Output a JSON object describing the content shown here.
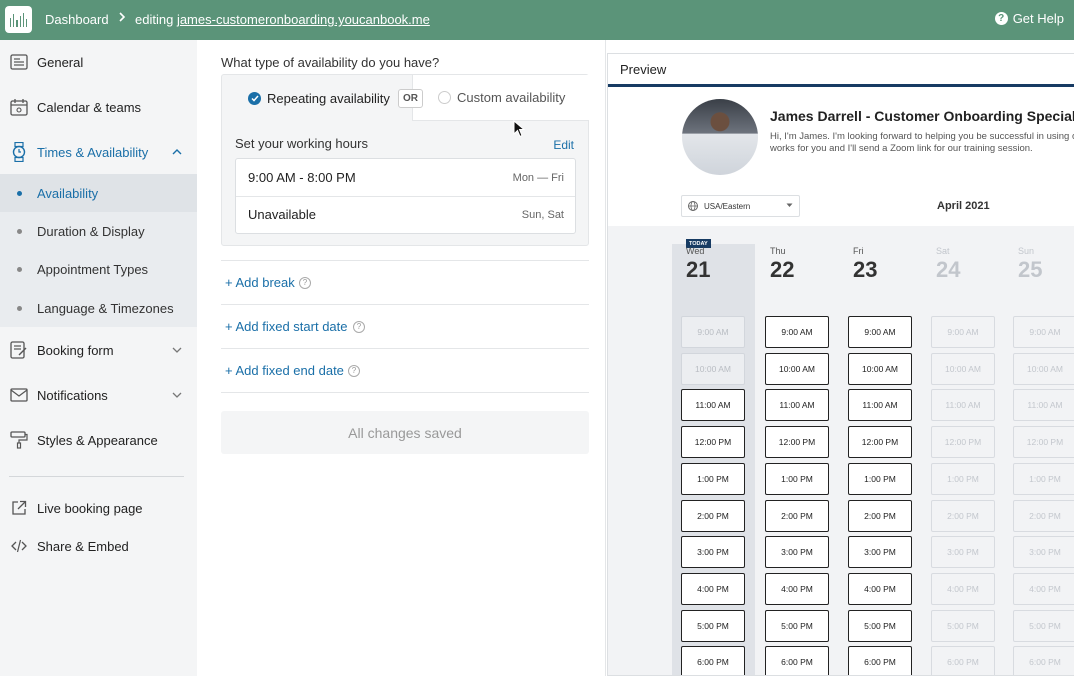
{
  "topbar": {
    "dashboard": "Dashboard",
    "separator": ">",
    "editing_prefix": "editing",
    "editing_link": "james-customeronboarding.youcanbook.me",
    "help": "Get Help"
  },
  "sidebar": {
    "items": [
      {
        "label": "General"
      },
      {
        "label": "Calendar & teams"
      },
      {
        "label": "Times & Availability"
      },
      {
        "label": "Booking form"
      },
      {
        "label": "Notifications"
      },
      {
        "label": "Styles & Appearance"
      },
      {
        "label": "Live booking page"
      },
      {
        "label": "Share & Embed"
      }
    ],
    "sub_items": [
      {
        "label": "Availability"
      },
      {
        "label": "Duration & Display"
      },
      {
        "label": "Appointment Types"
      },
      {
        "label": "Language & Timezones"
      }
    ]
  },
  "main": {
    "question": "What type of availability do you have?",
    "option_repeating": "Repeating availability",
    "or": "OR",
    "option_custom": "Custom availability",
    "working_hours_label": "Set your working hours",
    "edit": "Edit",
    "hours": [
      {
        "time": "9:00 AM - 8:00 PM",
        "days": "Mon — Fri"
      },
      {
        "time": "Unavailable",
        "days": "Sun, Sat"
      }
    ],
    "add_break": "+ Add break",
    "add_start": "+ Add fixed start date",
    "add_end": "+ Add fixed end date",
    "saved": "All changes saved"
  },
  "preview": {
    "title": "Preview",
    "name": "James Darrell - Customer Onboarding Specialist",
    "desc_line1": "Hi, I'm James. I'm looking forward to helping you be successful in using o",
    "desc_line2": "works for you and I'll send a Zoom link for our training session.",
    "timezone": "USA/Eastern",
    "month": "April 2021",
    "today_badge": "TODAY",
    "days": [
      {
        "name": "Wed",
        "date": "21",
        "dim": false
      },
      {
        "name": "Thu",
        "date": "22",
        "dim": false
      },
      {
        "name": "Fri",
        "date": "23",
        "dim": false
      },
      {
        "name": "Sat",
        "date": "24",
        "dim": true
      },
      {
        "name": "Sun",
        "date": "25",
        "dim": true
      }
    ],
    "slots": [
      "9:00 AM",
      "10:00 AM",
      "11:00 AM",
      "12:00 PM",
      "1:00 PM",
      "2:00 PM",
      "3:00 PM",
      "4:00 PM",
      "5:00 PM",
      "6:00 PM"
    ],
    "wed_unavailable_slots": [
      "9:00 AM",
      "10:00 AM"
    ]
  },
  "colors": {
    "topbar": "#5b9479",
    "accent": "#1a6fa8",
    "navy": "#173b63"
  }
}
